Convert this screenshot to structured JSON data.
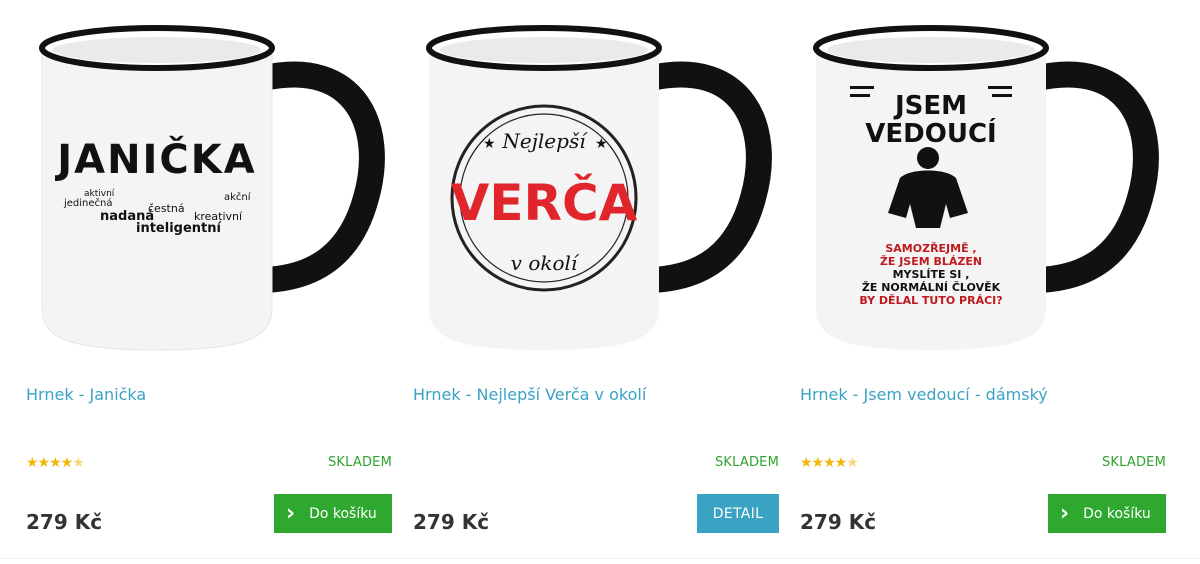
{
  "products": [
    {
      "name": "Hrnek - Janička",
      "image_text": [
        "JANIČKA",
        "jedinečná",
        "aktivní",
        "nadaná",
        "inteligentní",
        "čestná",
        "kreativní",
        "akční"
      ],
      "rating_stars": 4.5,
      "stock": "SKLADEM",
      "price": "279 Kč",
      "button_label": "Do košíku",
      "button_type": "cart"
    },
    {
      "name": "Hrnek - Nejlepší Verča v okolí",
      "image_text": [
        "Nejlepší",
        "VERČA",
        "v okolí"
      ],
      "rating_stars": null,
      "stock": "SKLADEM",
      "price": "279 Kč",
      "button_label": "DETAIL",
      "button_type": "detail"
    },
    {
      "name": "Hrnek - Jsem vedoucí - dámský",
      "image_text": [
        "JSEM",
        "VEDOUCÍ",
        "SAMOZŘEJMĚ ,",
        "ŽE JSEM BLÁZEN",
        "MYSLÍTE SI ,",
        "ŽE NORMÁLNÍ ČLOVĚK",
        "BY DĚLAL TUTO PRÁCI?"
      ],
      "rating_stars": 4.5,
      "stock": "SKLADEM",
      "price": "279 Kč",
      "button_label": "Do košíku",
      "button_type": "cart"
    }
  ],
  "colors": {
    "link": "#3aa3c4",
    "stock": "#2ea32e",
    "cart_button": "#2fa82f",
    "detail_button": "#3aa3c4",
    "star": "#f2b705"
  },
  "icons": {
    "cart_button_icon": "chevron-right-icon",
    "rating_icon": "star-icon"
  }
}
